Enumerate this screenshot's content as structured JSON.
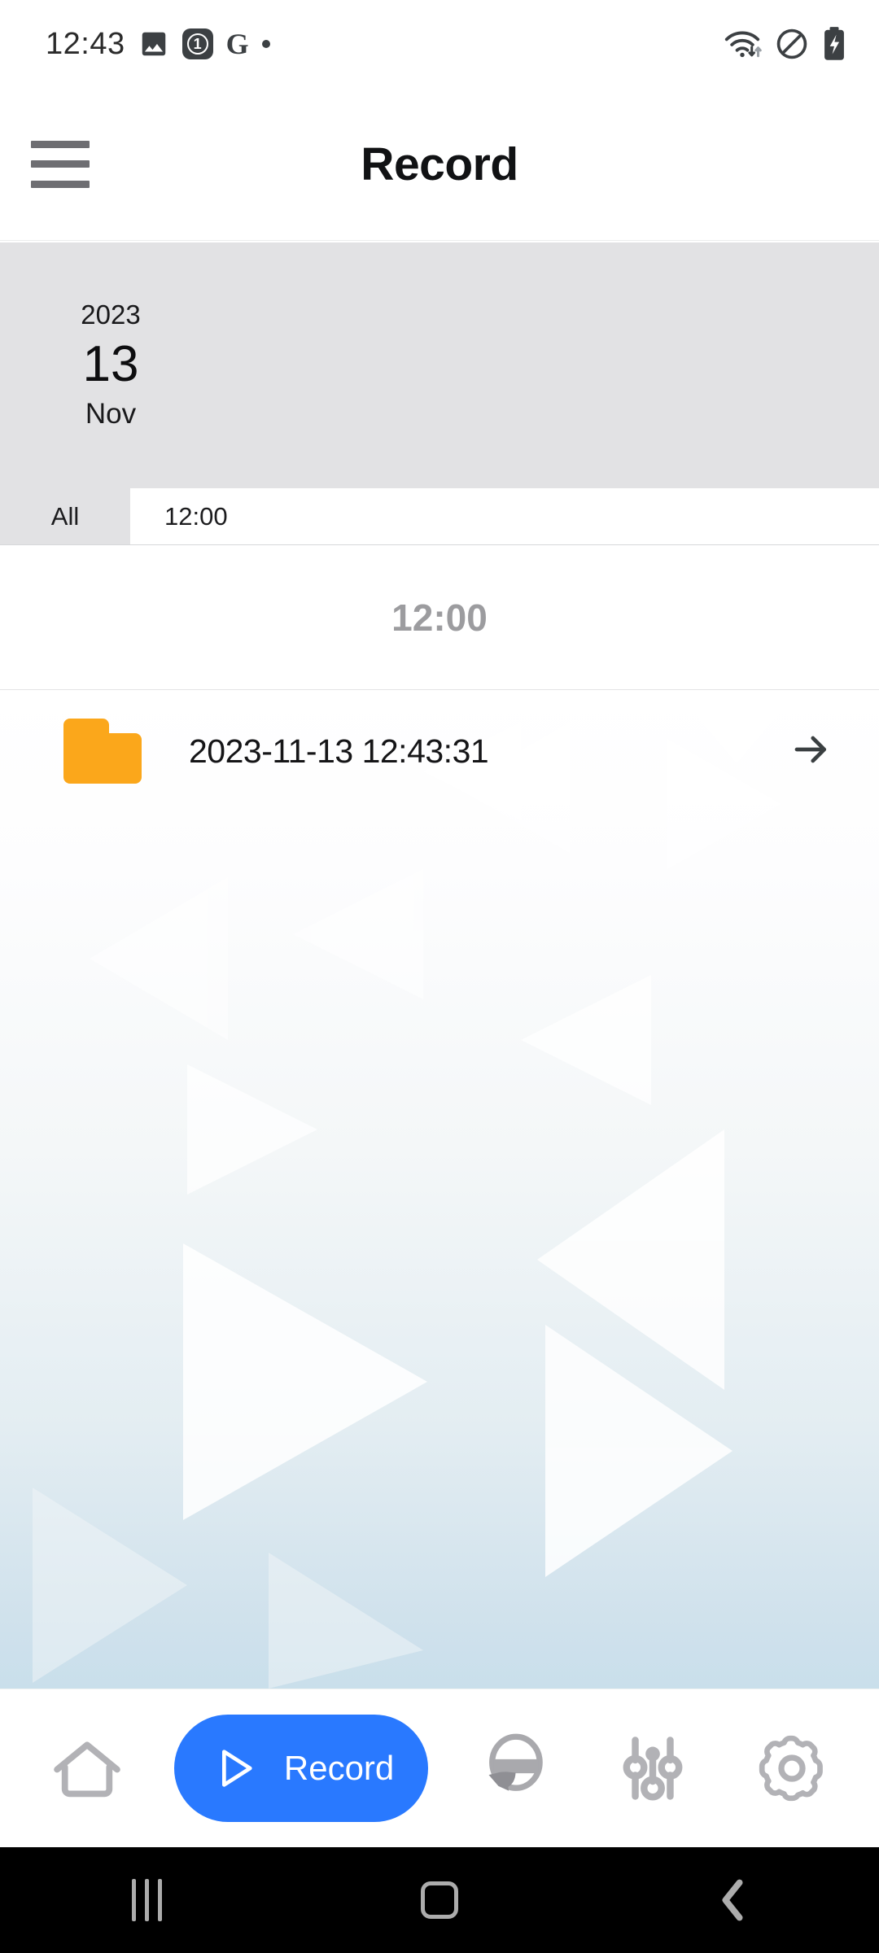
{
  "statusbar": {
    "clock": "12:43",
    "badge_count": "1",
    "google_glyph": "G",
    "icons_left": [
      "image-icon",
      "notification-count-badge",
      "google-icon",
      "dot-icon"
    ],
    "icons_right": [
      "wifi-transfer-icon",
      "do-not-disturb-icon",
      "battery-charging-icon"
    ]
  },
  "header": {
    "title": "Record",
    "menu_icon": "hamburger-menu-icon"
  },
  "date_card": {
    "year": "2023",
    "day": "13",
    "month": "Nov",
    "background_color": "#e2e2e4"
  },
  "filter_bar": {
    "all_label": "All",
    "time_label": "12:00"
  },
  "section": {
    "header": "12:00"
  },
  "file_list": {
    "rows": [
      {
        "icon": "folder-icon",
        "name": "2023-11-13 12:43:31",
        "arrow": "arrow-right-icon"
      }
    ]
  },
  "bottom_nav": {
    "items": [
      {
        "id": "home",
        "icon": "home-icon",
        "label": ""
      },
      {
        "id": "record",
        "icon": "play-icon",
        "label": "Record"
      },
      {
        "id": "driving",
        "icon": "steering-wheel-icon",
        "label": ""
      },
      {
        "id": "tuner",
        "icon": "sliders-icon",
        "label": ""
      },
      {
        "id": "settings",
        "icon": "gear-icon",
        "label": ""
      }
    ],
    "active": "record",
    "accent_color": "#2979ff",
    "inactive_color": "#b2b2b6"
  },
  "android_nav": {
    "recents": "recents-icon",
    "home": "home-square-icon",
    "back": "back-chevron-icon"
  },
  "colors": {
    "folder_orange": "#fba71b",
    "title_text": "#111214",
    "section_text": "#9c9c9f",
    "card_gray": "#e2e2e4"
  }
}
